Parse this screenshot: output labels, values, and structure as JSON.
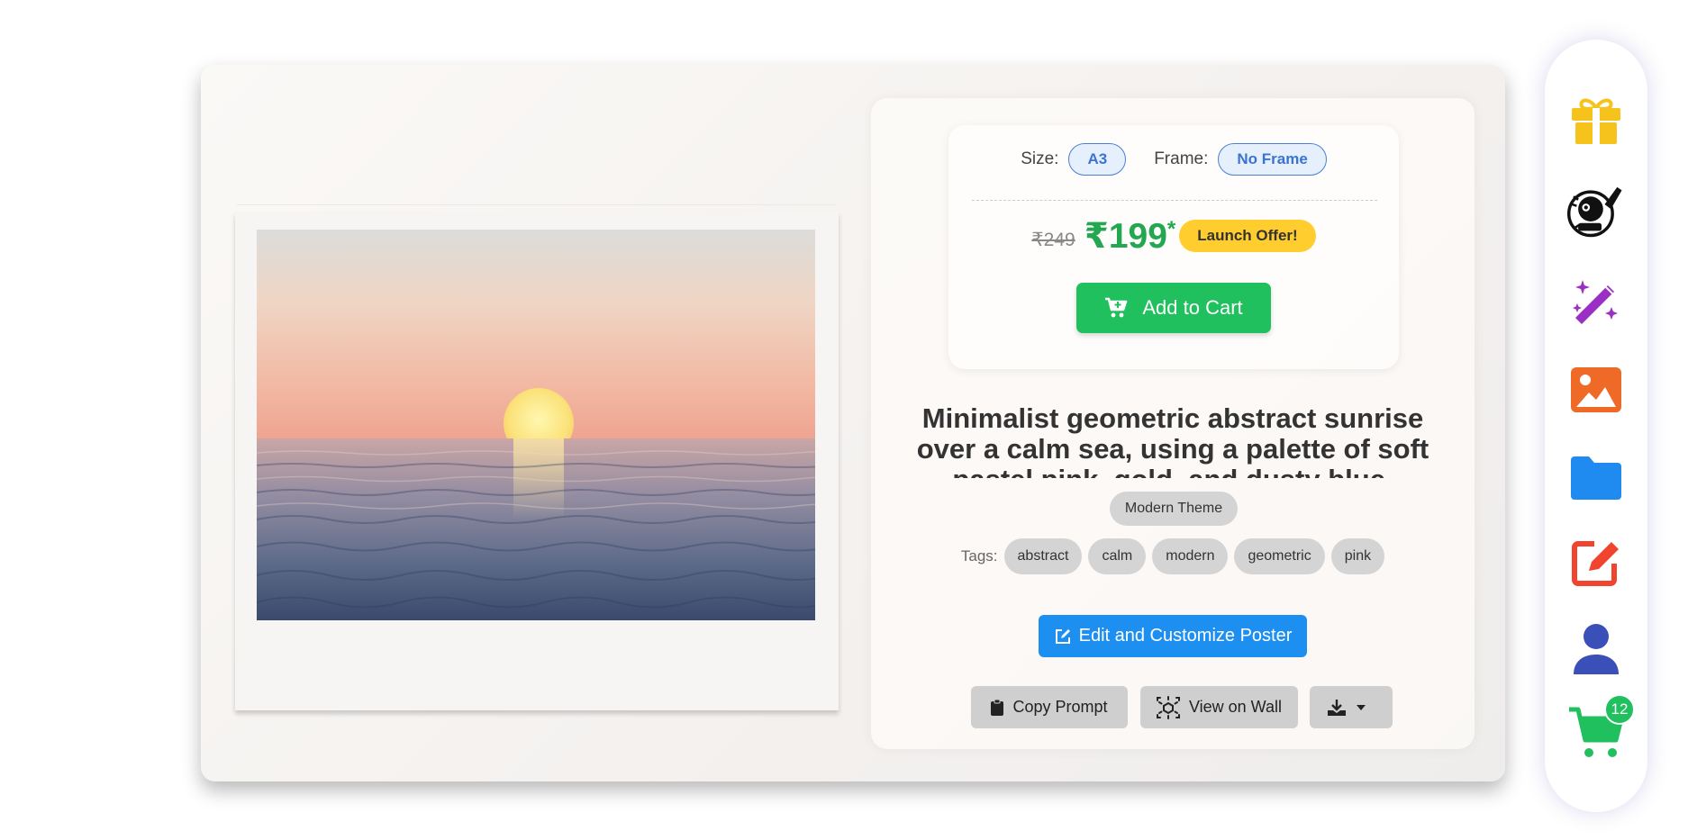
{
  "product": {
    "size_label": "Size:",
    "size_value": "A3",
    "frame_label": "Frame:",
    "frame_value": "No Frame",
    "old_price": "₹249",
    "new_price": "₹199",
    "price_asterisk": "*",
    "offer_label": "Launch Offer!",
    "add_to_cart_label": "Add to Cart",
    "title": "Minimalist geometric abstract sunrise over a calm sea, using a palette of soft pastel pink, gold, and dusty blue. Clean",
    "theme": "Modern Theme",
    "tags_label": "Tags:",
    "tags": [
      "abstract",
      "calm",
      "modern",
      "geometric",
      "pink"
    ],
    "edit_label": "Edit and Customize Poster",
    "copy_prompt_label": "Copy Prompt",
    "view_on_wall_label": "View on Wall"
  },
  "sidebar": {
    "items": [
      "gift-icon",
      "robot-artist-icon",
      "magic-wand-icon",
      "image-icon",
      "folder-icon",
      "edit-icon",
      "user-icon",
      "cart-icon"
    ],
    "cart_count": "12"
  },
  "colors": {
    "price_green": "#23a851",
    "cart_green": "#21c05e",
    "offer_yellow": "#ffcd2e",
    "primary_blue": "#1d8ff0",
    "chip_blue": "#3b73d1"
  }
}
